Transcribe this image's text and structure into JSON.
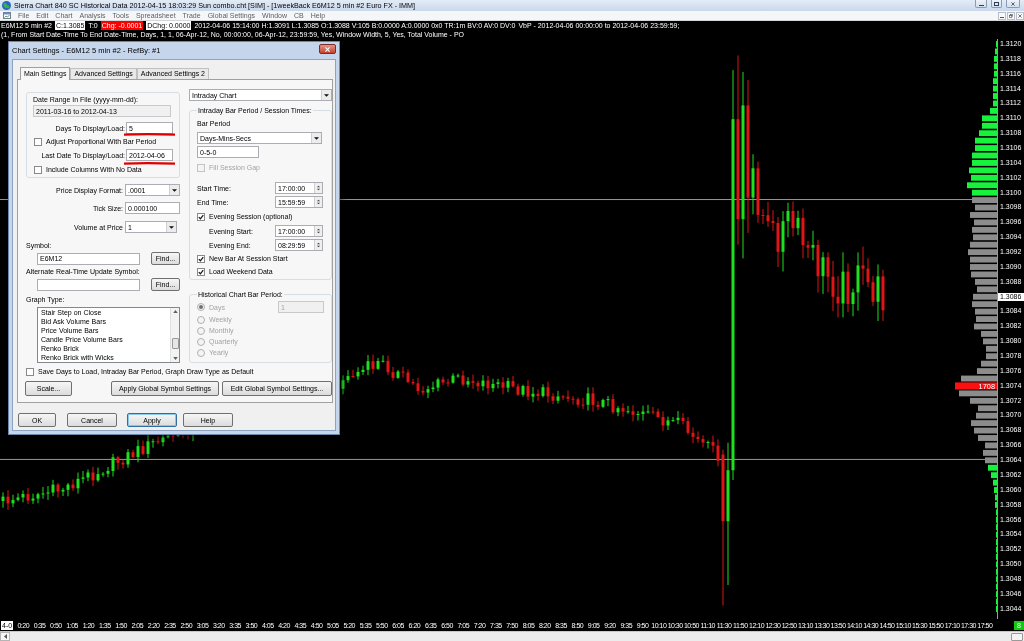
{
  "app_window": {
    "title": "Sierra Chart 840 SC Historical Data 2012-04-15 18:03:29 Sun combo.cht [SIM] - [1weekBack E6M12 5 min #2 Euro FX - IMM]"
  },
  "menu": [
    "File",
    "Edit",
    "Chart",
    "Analysis",
    "Tools",
    "Spreadsheet",
    "Trade",
    "Global Settings",
    "Window",
    "CB",
    "Help"
  ],
  "info_bar": {
    "segments": [
      {
        "kind": "plain",
        "text": "E6M12 5 min #2"
      },
      {
        "kind": "boxed",
        "text": "C:1.3085"
      },
      {
        "kind": "plain",
        "text": "T:0"
      },
      {
        "kind": "alert",
        "text": "Chg: -0.0001"
      },
      {
        "kind": "boxed",
        "text": "DChg: 0.0000"
      },
      {
        "kind": "plain",
        "text": "2012-04-06 15:14:00 H:1.3091 L:1.3085 O:1.3088 V:105 B:0.0000 A:0.0000 0x0 TR:1m BV:0 AV:0 DV:0"
      },
      {
        "kind": "plain",
        "text": "VbP - 2012-04-06 00:00:00 to 2012-04-06 23:59:59;"
      },
      {
        "kind": "plain",
        "text": "(1, From Start Date-Time To End Date-Time, Days, 1, 1, 06-Apr-12, No, 00:00:00, 06-Apr-12, 23:59:59, Yes, Window Width, 5, Yes, Total Volume - PO"
      }
    ]
  },
  "price_axis": {
    "labels": [
      {
        "text": "1.3120",
        "current": false
      },
      {
        "text": "1.3118",
        "current": false
      },
      {
        "text": "1.3116",
        "current": false
      },
      {
        "text": "1.3114",
        "current": false
      },
      {
        "text": "1.3112",
        "current": false
      },
      {
        "text": "1.3110",
        "current": false
      },
      {
        "text": "1.3108",
        "current": false
      },
      {
        "text": "1.3106",
        "current": false
      },
      {
        "text": "1.3104",
        "current": false
      },
      {
        "text": "1.3102",
        "current": false
      },
      {
        "text": "1.3100",
        "current": false
      },
      {
        "text": "1.3098",
        "current": false
      },
      {
        "text": "1.3096",
        "current": false
      },
      {
        "text": "1.3094",
        "current": false
      },
      {
        "text": "1.3092",
        "current": false
      },
      {
        "text": "1.3090",
        "current": false
      },
      {
        "text": "1.3088",
        "current": false
      },
      {
        "text": "1.3086",
        "current": true
      },
      {
        "text": "1.3084",
        "current": false
      },
      {
        "text": "1.3082",
        "current": false
      },
      {
        "text": "1.3080",
        "current": false
      },
      {
        "text": "1.3078",
        "current": false
      },
      {
        "text": "1.3076",
        "current": false
      },
      {
        "text": "1.3074",
        "current": false
      },
      {
        "text": "1.3072",
        "current": false
      },
      {
        "text": "1.3070",
        "current": false
      },
      {
        "text": "1.3068",
        "current": false
      },
      {
        "text": "1.3066",
        "current": false
      },
      {
        "text": "1.3064",
        "current": false
      },
      {
        "text": "1.3062",
        "current": false
      },
      {
        "text": "1.3060",
        "current": false
      },
      {
        "text": "1.3058",
        "current": false
      },
      {
        "text": "1.3056",
        "current": false
      },
      {
        "text": "1.3054",
        "current": false
      },
      {
        "text": "1.3052",
        "current": false
      },
      {
        "text": "1.3050",
        "current": false
      },
      {
        "text": "1.3048",
        "current": false
      },
      {
        "text": "1.3046",
        "current": false
      },
      {
        "text": "1.3044",
        "current": false
      }
    ]
  },
  "volume_profile": {
    "poc_volume": "1708"
  },
  "time_axis": {
    "corner_label": "4-0",
    "labels": [
      "0:20",
      "0:35",
      "0:50",
      "1:05",
      "1:20",
      "1:35",
      "1:50",
      "2:05",
      "2:20",
      "2:35",
      "2:50",
      "3:05",
      "3:20",
      "3:35",
      "3:50",
      "4:05",
      "4:20",
      "4:35",
      "4:50",
      "5:05",
      "5:20",
      "5:35",
      "5:50",
      "6:05",
      "6:20",
      "6:35",
      "6:50",
      "7:05",
      "7:20",
      "7:35",
      "7:50",
      "8:05",
      "8:20",
      "8:35",
      "8:50",
      "9:05",
      "9:20",
      "9:35",
      "9:50",
      "10:10",
      "10:30",
      "10:50",
      "11:10",
      "11:30",
      "11:50",
      "12:10",
      "12:30",
      "12:50",
      "13:10",
      "13:30",
      "13:50",
      "14:10",
      "14:30",
      "14:50",
      "15:10",
      "15:30",
      "15:50",
      "17:10",
      "17:30",
      "17:50"
    ],
    "status_badge": "8"
  },
  "dialog": {
    "title": "Chart Settings - E6M12 5 min #2 - RefBy: #1",
    "tabs": [
      {
        "label": "Main Settings",
        "selected": true
      },
      {
        "label": "Advanced Settings",
        "selected": false
      },
      {
        "label": "Advanced Settings 2",
        "selected": false
      }
    ],
    "date_range": {
      "label": "Date Range In File (yyyy-mm-dd):",
      "value": "2011-03-16 to 2012-04-13"
    },
    "days_to_load": {
      "label": "Days To Display/Load:",
      "value": "5",
      "underlined": true
    },
    "adjust_proportional": {
      "label": "Adjust Proportional With Bar Period",
      "checked": false
    },
    "last_date": {
      "label": "Last Date To Display/Load:",
      "value": "2012-04-06",
      "underlined": true
    },
    "include_columns": {
      "label": "Include Columns With No Data",
      "checked": false
    },
    "price_display_format": {
      "label": "Price Display Format:",
      "value": ".0001"
    },
    "tick_size": {
      "label": "Tick Size:",
      "value": "0.000100"
    },
    "volume_at_price": {
      "label": "Volume at Price",
      "value": "1"
    },
    "symbol": {
      "label": "Symbol:",
      "value": "E6M12",
      "button": "Find..."
    },
    "alternate_symbol": {
      "label": "Alternate Real-Time Update Symbol:",
      "button": "Find..."
    },
    "graph_type": {
      "label": "Graph Type:",
      "items": [
        {
          "label": "Stair Step on Close",
          "selected": false
        },
        {
          "label": "Bid Ask Volume Bars",
          "selected": false
        },
        {
          "label": "Price Volume Bars",
          "selected": false
        },
        {
          "label": "Candle Price Volume Bars",
          "selected": false
        },
        {
          "label": "Renko Brick",
          "selected": false
        },
        {
          "label": "Renko Brick with Wicks",
          "selected": false
        }
      ]
    },
    "chart_type": {
      "value": "Intraday Chart"
    },
    "intraday_group": {
      "title": "Intraday Bar Period / Session Times:",
      "bar_period_label": "Bar Period",
      "bar_period_unit": "Days-Mins-Secs",
      "bar_period_value": "0-5-0",
      "fill_session_gap": {
        "label": "Fill Session Gap",
        "checked": false,
        "disabled": true
      },
      "start_time": {
        "label": "Start Time:",
        "value": "17:00:00"
      },
      "end_time": {
        "label": "End Time:",
        "value": "15:59:59"
      },
      "evening_session": {
        "label": "Evening Session (optional)",
        "checked": true
      },
      "evening_start": {
        "label": "Evening Start:",
        "value": "17:00:00"
      },
      "evening_end": {
        "label": "Evening End:",
        "value": "08:29:59"
      },
      "new_bar_at_session_start": {
        "label": "New Bar At Session Start",
        "checked": true
      },
      "load_weekend_data": {
        "label": "Load Weekend Data",
        "checked": true
      }
    },
    "historical_group": {
      "title": "Historical Chart Bar Period:",
      "disabled": true,
      "value": "1",
      "options": [
        {
          "label": "Days",
          "selected": true
        },
        {
          "label": "Weekly",
          "selected": false
        },
        {
          "label": "Monthly",
          "selected": false
        },
        {
          "label": "Quarterly",
          "selected": false
        },
        {
          "label": "Yearly",
          "selected": false
        }
      ]
    },
    "save_as_default": {
      "label": "Save Days to Load, Intraday Bar Period, Graph Draw Type as Default",
      "checked": false
    },
    "buttons": [
      {
        "label": "Scale..."
      },
      {
        "label": "Apply Global Symbol Settings"
      },
      {
        "label": "Edit Global Symbol Settings..."
      }
    ],
    "footer_buttons": [
      {
        "label": "OK",
        "default": false
      },
      {
        "label": "Cancel",
        "default": false
      },
      {
        "label": "Apply",
        "default": true
      },
      {
        "label": "Help",
        "default": false
      }
    ]
  }
}
